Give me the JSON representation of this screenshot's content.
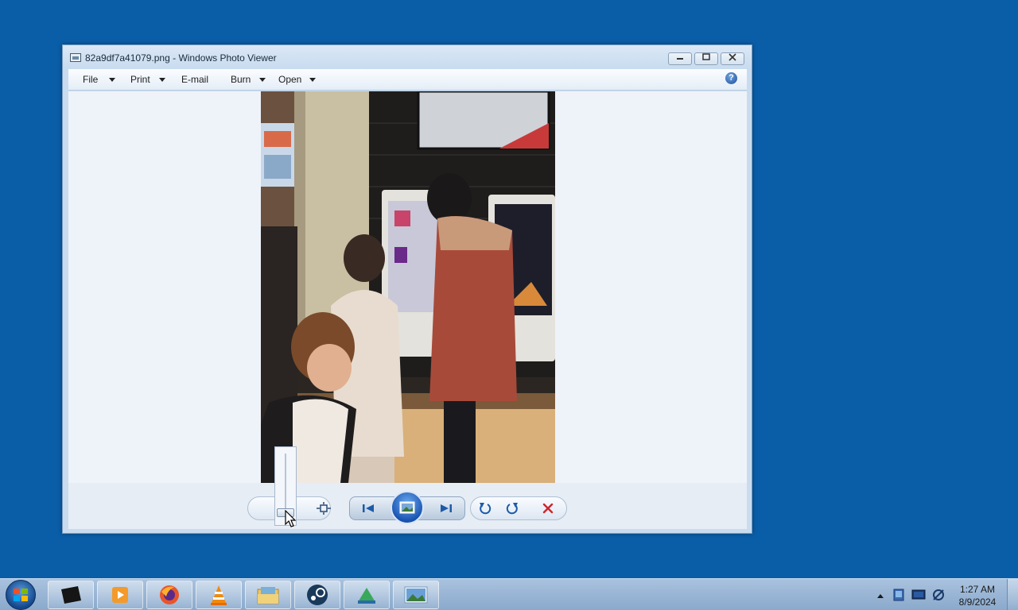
{
  "window": {
    "title": "82a9df7a41079.png - Windows Photo Viewer",
    "controls": {
      "minimize": "minimize-icon",
      "maximize": "maximize-icon",
      "close": "close-icon"
    }
  },
  "menu": {
    "items": [
      {
        "label": "File",
        "has_dropdown": true
      },
      {
        "label": "Print",
        "has_dropdown": true
      },
      {
        "label": "E-mail",
        "has_dropdown": false
      },
      {
        "label": "Burn",
        "has_dropdown": true
      },
      {
        "label": "Open",
        "has_dropdown": true
      }
    ],
    "help": "?"
  },
  "toolbar": {
    "buttons": [
      "zoom-icon",
      "actual-size-icon",
      "previous-icon",
      "slideshow-icon",
      "next-icon",
      "rotate-counterclockwise-icon",
      "rotate-clockwise-icon",
      "delete-icon"
    ],
    "zoom_level": 0.05
  },
  "taskbar": {
    "apps": [
      "terminal-icon",
      "media-player-icon",
      "firefox-icon",
      "vlc-icon",
      "file-manager-icon",
      "steam-icon",
      "app-icon",
      "photo-viewer-icon"
    ],
    "tray_icons": [
      "show-hidden-icons-icon",
      "network-icon",
      "display-icon",
      "speaker-icon"
    ],
    "clock": {
      "time": "1:27 AM",
      "date": "8/9/2024"
    }
  },
  "colors": {
    "desktop": "#0a5ea8",
    "window_frame": "#c9dcef",
    "viewer_background": "#eef3f9",
    "delete_red": "#d0242b"
  }
}
